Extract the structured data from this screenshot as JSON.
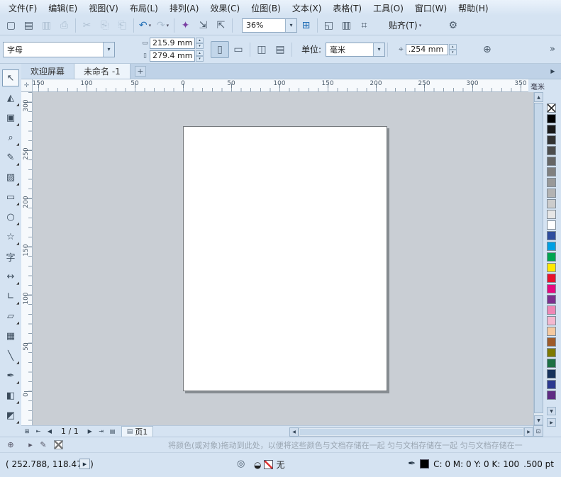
{
  "menubar": {
    "items": [
      "文件(F)",
      "编辑(E)",
      "视图(V)",
      "布局(L)",
      "排列(A)",
      "效果(C)",
      "位图(B)",
      "文本(X)",
      "表格(T)",
      "工具(O)",
      "窗口(W)",
      "帮助(H)"
    ]
  },
  "toolbar": {
    "zoom_value": "36%",
    "snap_label": "贴齐(T)",
    "items": [
      {
        "t": "btn",
        "name": "new-document",
        "glyph": "▢"
      },
      {
        "t": "btn",
        "name": "open-file",
        "glyph": "▤"
      },
      {
        "t": "btn",
        "name": "save",
        "glyph": "▥",
        "disabled": true
      },
      {
        "t": "btn",
        "name": "print",
        "glyph": "⎙",
        "disabled": true
      },
      {
        "t": "sep"
      },
      {
        "t": "btn",
        "name": "cut",
        "glyph": "✂",
        "disabled": true
      },
      {
        "t": "btn",
        "name": "copy",
        "glyph": "⎘",
        "disabled": true
      },
      {
        "t": "btn",
        "name": "paste",
        "glyph": "⎗",
        "disabled": true
      },
      {
        "t": "sep"
      },
      {
        "t": "btn",
        "name": "undo",
        "glyph": "↶",
        "accent": true,
        "dropdown": true
      },
      {
        "t": "btn",
        "name": "redo",
        "glyph": "↷",
        "disabled": true,
        "dropdown": true
      },
      {
        "t": "sep"
      },
      {
        "t": "btn",
        "name": "corel-connect",
        "glyph": "✦",
        "purple": true
      },
      {
        "t": "btn",
        "name": "import",
        "glyph": "⇲"
      },
      {
        "t": "btn",
        "name": "export",
        "glyph": "⇱"
      },
      {
        "t": "sep"
      },
      {
        "t": "zoom"
      },
      {
        "t": "btn",
        "name": "welcome-screen",
        "glyph": "⊞",
        "accent": true
      },
      {
        "t": "sep"
      },
      {
        "t": "btn",
        "name": "fullscreen-preview",
        "glyph": "◱"
      },
      {
        "t": "btn",
        "name": "show-rulers",
        "glyph": "▥"
      },
      {
        "t": "btn",
        "name": "view-navigator",
        "glyph": "⌗"
      },
      {
        "t": "snap"
      },
      {
        "t": "btn",
        "name": "options",
        "glyph": "⚙"
      }
    ]
  },
  "propbar": {
    "preset_value": "字母",
    "page_width": "215.9 mm",
    "page_height": "279.4 mm",
    "units_label": "单位:",
    "units_value": "毫米",
    "nudge_value": ".254 mm"
  },
  "tabbar": {
    "tabs": [
      {
        "label": "欢迎屏幕",
        "active": false
      },
      {
        "label": "未命名 -1",
        "active": true
      }
    ],
    "add_label": "+"
  },
  "rulers": {
    "h_labels": [
      "150",
      "100",
      "50",
      "0",
      "50",
      "100",
      "150",
      "200",
      "250",
      "300",
      "350"
    ],
    "v_labels": [
      "300",
      "250",
      "200",
      "150",
      "100",
      "50",
      "0"
    ],
    "unit_label": "毫米"
  },
  "toolbox": {
    "tools": [
      {
        "name": "pick-tool",
        "glyph": "↖",
        "selected": true
      },
      {
        "name": "shape-tool",
        "glyph": "◭",
        "flyout": true
      },
      {
        "name": "crop-tool",
        "glyph": "▣",
        "flyout": true
      },
      {
        "name": "zoom-tool",
        "glyph": "⌕",
        "flyout": true
      },
      {
        "name": "freehand-tool",
        "glyph": "✎",
        "flyout": true
      },
      {
        "name": "smart-fill-tool",
        "glyph": "▨",
        "flyout": true
      },
      {
        "name": "rectangle-tool",
        "glyph": "▭",
        "flyout": true
      },
      {
        "name": "ellipse-tool",
        "glyph": "○",
        "flyout": true
      },
      {
        "name": "polygon-tool",
        "glyph": "☆",
        "flyout": true
      },
      {
        "name": "text-tool",
        "glyph": "字"
      },
      {
        "name": "parallel-dimension-tool",
        "glyph": "↔",
        "flyout": true
      },
      {
        "name": "connector-tool",
        "glyph": "∟",
        "flyout": true
      },
      {
        "name": "drop-shadow-tool",
        "glyph": "▱",
        "flyout": true
      },
      {
        "name": "transparency-tool",
        "glyph": "▦"
      },
      {
        "name": "color-eyedropper-tool",
        "glyph": "╲",
        "flyout": true
      },
      {
        "name": "outline-pen-tool",
        "glyph": "✒",
        "flyout": true
      },
      {
        "name": "fill-tool",
        "glyph": "◧",
        "flyout": true
      },
      {
        "name": "interactive-fill-tool",
        "glyph": "◩",
        "flyout": true
      }
    ]
  },
  "palette": {
    "colors": [
      "#000000",
      "#1a1a1a",
      "#333333",
      "#4d4d4d",
      "#666666",
      "#808080",
      "#999999",
      "#b3b3b3",
      "#cccccc",
      "#e6e6e6",
      "#ffffff",
      "#2e4d9e",
      "#00a0e3",
      "#00a551",
      "#ffe800",
      "#e8112d",
      "#e5097f",
      "#7d2f8e",
      "#ef87b5",
      "#f4b8cf",
      "#f5c99f",
      "#9e5b2a",
      "#7f7a00",
      "#1d7044",
      "#16325c",
      "#2b3990",
      "#5f2c83"
    ]
  },
  "pagebar": {
    "page_indicator": "1 / 1",
    "page_tab_label": "页1"
  },
  "statusbar": {
    "palette_hint": "将颜色(或对象)拖动到此处，以便将这些颜色与文档存储在一起",
    "palette_hint_repeat": "匀与文档存储在一起  匀与文档存储在一",
    "coords": "( 252.788, 118.477 )",
    "fill_none_label": "无",
    "outline_color_values": "C: 0 M: 0 Y: 0 K: 100",
    "outline_width": ".500 pt"
  },
  "icons": {
    "chevron_down": "▾",
    "spin_up": "▴",
    "spin_down": "▾",
    "flyout_corner": "◢",
    "overflow": "»",
    "portrait": "▯",
    "landscape": "▭",
    "all_pages": "◫",
    "current_page": "▤",
    "width_icon": "▭",
    "height_icon": "▯",
    "nudge": "⌖",
    "duplicate": "⊕",
    "ruler_origin": "✛",
    "tab_scroll": "▶",
    "add_page": "⊞",
    "first_page": "⇤",
    "prev_page": "◀",
    "next_page": "▶",
    "last_page": "⇥",
    "page_menu": "▤",
    "page_tab_icon": "▤",
    "hscroll_left": "◀",
    "hscroll_right": "▶",
    "vscroll_up": "▲",
    "vscroll_down": "▼",
    "navigator": "⊡",
    "palette_down": "▼",
    "palette_fly": "▶",
    "dock_plus": "⊕",
    "dock_arrow": "▸",
    "dock_pen": "✎",
    "status_menu": "▶",
    "proof": "◎",
    "fill_bucket": "◒",
    "outline_pen": "✒"
  }
}
